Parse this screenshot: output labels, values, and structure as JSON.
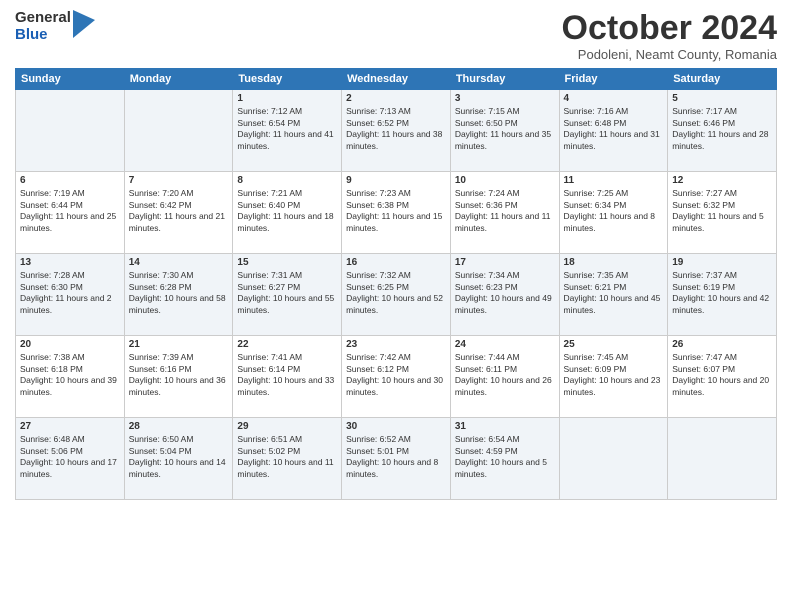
{
  "header": {
    "logo_general": "General",
    "logo_blue": "Blue",
    "title": "October 2024",
    "location": "Podoleni, Neamt County, Romania"
  },
  "weekdays": [
    "Sunday",
    "Monday",
    "Tuesday",
    "Wednesday",
    "Thursday",
    "Friday",
    "Saturday"
  ],
  "rows": [
    [
      {
        "day": "",
        "content": ""
      },
      {
        "day": "",
        "content": ""
      },
      {
        "day": "1",
        "content": "Sunrise: 7:12 AM\nSunset: 6:54 PM\nDaylight: 11 hours and 41 minutes."
      },
      {
        "day": "2",
        "content": "Sunrise: 7:13 AM\nSunset: 6:52 PM\nDaylight: 11 hours and 38 minutes."
      },
      {
        "day": "3",
        "content": "Sunrise: 7:15 AM\nSunset: 6:50 PM\nDaylight: 11 hours and 35 minutes."
      },
      {
        "day": "4",
        "content": "Sunrise: 7:16 AM\nSunset: 6:48 PM\nDaylight: 11 hours and 31 minutes."
      },
      {
        "day": "5",
        "content": "Sunrise: 7:17 AM\nSunset: 6:46 PM\nDaylight: 11 hours and 28 minutes."
      }
    ],
    [
      {
        "day": "6",
        "content": "Sunrise: 7:19 AM\nSunset: 6:44 PM\nDaylight: 11 hours and 25 minutes."
      },
      {
        "day": "7",
        "content": "Sunrise: 7:20 AM\nSunset: 6:42 PM\nDaylight: 11 hours and 21 minutes."
      },
      {
        "day": "8",
        "content": "Sunrise: 7:21 AM\nSunset: 6:40 PM\nDaylight: 11 hours and 18 minutes."
      },
      {
        "day": "9",
        "content": "Sunrise: 7:23 AM\nSunset: 6:38 PM\nDaylight: 11 hours and 15 minutes."
      },
      {
        "day": "10",
        "content": "Sunrise: 7:24 AM\nSunset: 6:36 PM\nDaylight: 11 hours and 11 minutes."
      },
      {
        "day": "11",
        "content": "Sunrise: 7:25 AM\nSunset: 6:34 PM\nDaylight: 11 hours and 8 minutes."
      },
      {
        "day": "12",
        "content": "Sunrise: 7:27 AM\nSunset: 6:32 PM\nDaylight: 11 hours and 5 minutes."
      }
    ],
    [
      {
        "day": "13",
        "content": "Sunrise: 7:28 AM\nSunset: 6:30 PM\nDaylight: 11 hours and 2 minutes."
      },
      {
        "day": "14",
        "content": "Sunrise: 7:30 AM\nSunset: 6:28 PM\nDaylight: 10 hours and 58 minutes."
      },
      {
        "day": "15",
        "content": "Sunrise: 7:31 AM\nSunset: 6:27 PM\nDaylight: 10 hours and 55 minutes."
      },
      {
        "day": "16",
        "content": "Sunrise: 7:32 AM\nSunset: 6:25 PM\nDaylight: 10 hours and 52 minutes."
      },
      {
        "day": "17",
        "content": "Sunrise: 7:34 AM\nSunset: 6:23 PM\nDaylight: 10 hours and 49 minutes."
      },
      {
        "day": "18",
        "content": "Sunrise: 7:35 AM\nSunset: 6:21 PM\nDaylight: 10 hours and 45 minutes."
      },
      {
        "day": "19",
        "content": "Sunrise: 7:37 AM\nSunset: 6:19 PM\nDaylight: 10 hours and 42 minutes."
      }
    ],
    [
      {
        "day": "20",
        "content": "Sunrise: 7:38 AM\nSunset: 6:18 PM\nDaylight: 10 hours and 39 minutes."
      },
      {
        "day": "21",
        "content": "Sunrise: 7:39 AM\nSunset: 6:16 PM\nDaylight: 10 hours and 36 minutes."
      },
      {
        "day": "22",
        "content": "Sunrise: 7:41 AM\nSunset: 6:14 PM\nDaylight: 10 hours and 33 minutes."
      },
      {
        "day": "23",
        "content": "Sunrise: 7:42 AM\nSunset: 6:12 PM\nDaylight: 10 hours and 30 minutes."
      },
      {
        "day": "24",
        "content": "Sunrise: 7:44 AM\nSunset: 6:11 PM\nDaylight: 10 hours and 26 minutes."
      },
      {
        "day": "25",
        "content": "Sunrise: 7:45 AM\nSunset: 6:09 PM\nDaylight: 10 hours and 23 minutes."
      },
      {
        "day": "26",
        "content": "Sunrise: 7:47 AM\nSunset: 6:07 PM\nDaylight: 10 hours and 20 minutes."
      }
    ],
    [
      {
        "day": "27",
        "content": "Sunrise: 6:48 AM\nSunset: 5:06 PM\nDaylight: 10 hours and 17 minutes."
      },
      {
        "day": "28",
        "content": "Sunrise: 6:50 AM\nSunset: 5:04 PM\nDaylight: 10 hours and 14 minutes."
      },
      {
        "day": "29",
        "content": "Sunrise: 6:51 AM\nSunset: 5:02 PM\nDaylight: 10 hours and 11 minutes."
      },
      {
        "day": "30",
        "content": "Sunrise: 6:52 AM\nSunset: 5:01 PM\nDaylight: 10 hours and 8 minutes."
      },
      {
        "day": "31",
        "content": "Sunrise: 6:54 AM\nSunset: 4:59 PM\nDaylight: 10 hours and 5 minutes."
      },
      {
        "day": "",
        "content": ""
      },
      {
        "day": "",
        "content": ""
      }
    ]
  ]
}
